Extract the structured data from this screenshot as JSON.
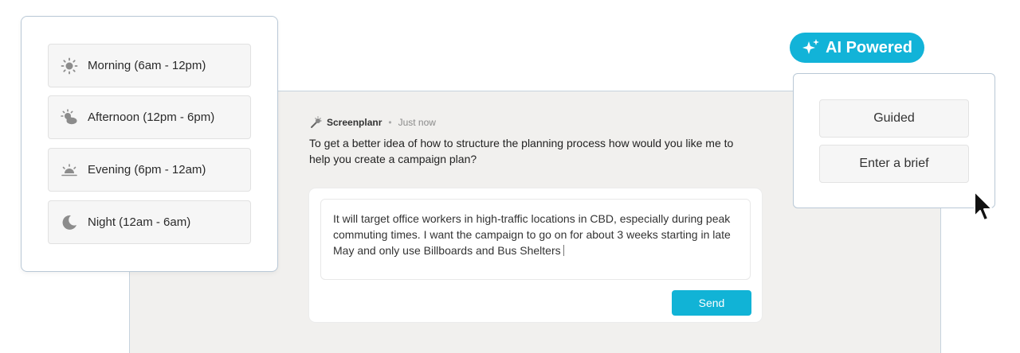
{
  "time_options": [
    {
      "label": "Morning (6am - 12pm)",
      "icon": "sun-icon"
    },
    {
      "label": "Afternoon (12pm - 6pm)",
      "icon": "sun-cloud-icon"
    },
    {
      "label": "Evening (6pm - 12am)",
      "icon": "sunset-icon"
    },
    {
      "label": "Night (12am - 6am)",
      "icon": "moon-icon"
    }
  ],
  "chat": {
    "sender": "Screenplanr",
    "separator": "•",
    "timestamp": "Just now",
    "message": "To get a better idea of how to structure the planning process how would you like me to help you create a campaign plan?",
    "input_value": "It will target office workers in high-traffic locations in CBD, especially during peak commuting times. I want the campaign to go on for about 3 weeks starting in late May and only use Billboards and Bus Shelters",
    "send_label": "Send"
  },
  "badge": {
    "label": "AI Powered",
    "icon": "sparkle-icon"
  },
  "modes": [
    {
      "label": "Guided"
    },
    {
      "label": "Enter a brief"
    }
  ],
  "colors": {
    "accent": "#12b3d8",
    "panel_bg": "#f1f0ee",
    "card_border": "#b9c8d6"
  }
}
